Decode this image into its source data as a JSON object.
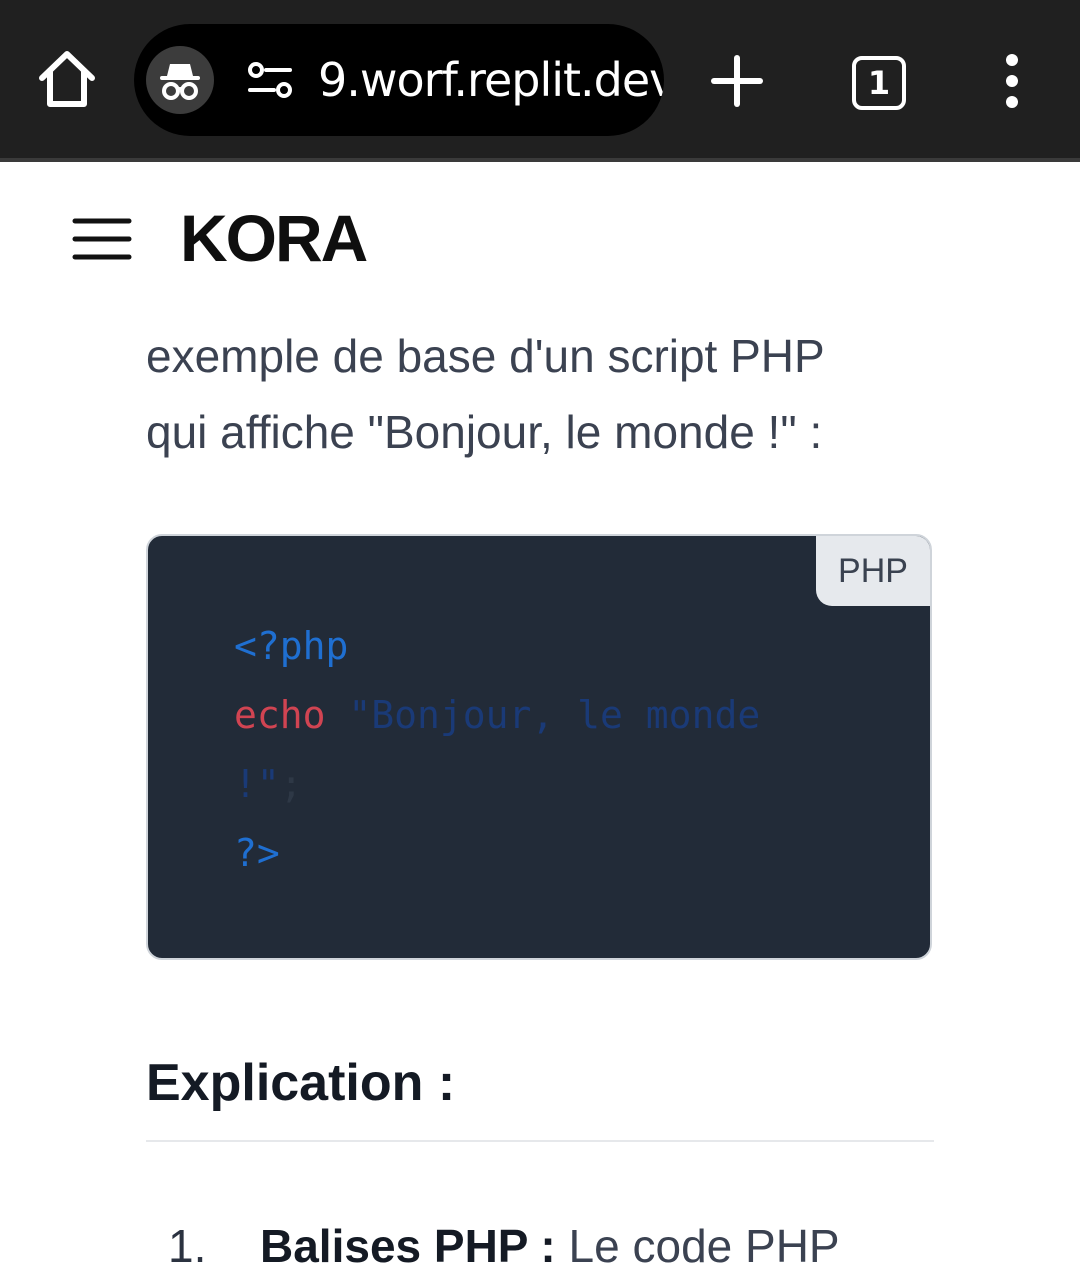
{
  "browser": {
    "url_text": "9.worf.replit.dev",
    "tab_count": "1"
  },
  "site": {
    "brand": "KORA"
  },
  "content": {
    "intro_line1": "exemple de base d'un script PHP",
    "intro_line2": "qui affiche \"Bonjour, le monde !\" :",
    "code_language": "PHP",
    "code": {
      "line1": "<?php",
      "line2_keyword": "echo",
      "line2_string": " \"Bonjour, le monde",
      "line3_string": "!\"",
      "line3_punc": ";",
      "line4": "?>"
    },
    "section_title": "Explication :",
    "list": [
      {
        "number": "1.",
        "term": "Balises PHP",
        "separator": " : ",
        "text": "Le code PHP"
      }
    ]
  },
  "colors": {
    "browser_bar": "#202020",
    "code_background": "#222b38",
    "code_tag": "#1f6fd1",
    "code_keyword": "#d14452"
  }
}
